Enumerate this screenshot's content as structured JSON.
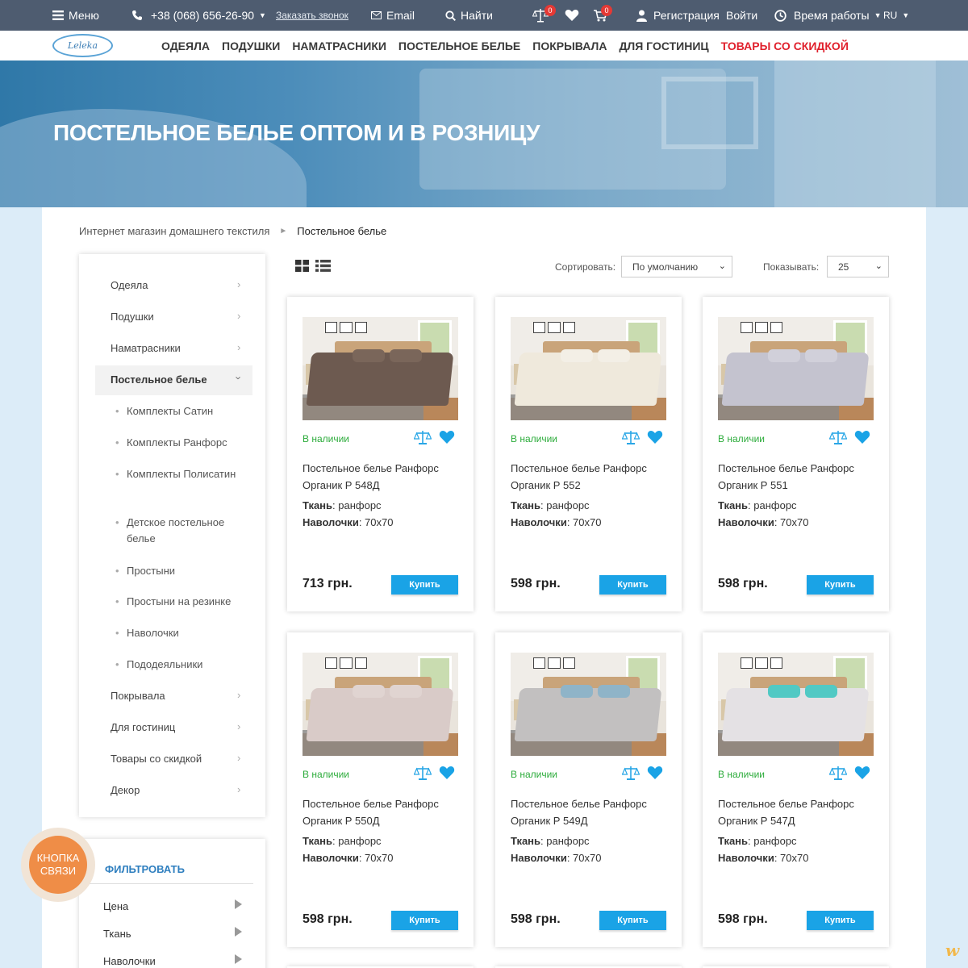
{
  "topbar": {
    "menu": "Меню",
    "phone": "+38 (068) 656-26-90",
    "callback": "Заказать звонок",
    "email": "Email",
    "search": "Найти",
    "compare_count": "0",
    "cart_count": "0",
    "register": "Регистрация",
    "login": "Войти",
    "hours": "Время работы",
    "lang": "RU"
  },
  "nav": {
    "logo": "Leleka",
    "items": [
      "ОДЕЯЛА",
      "ПОДУШКИ",
      "НАМАТРАСНИКИ",
      "ПОСТЕЛЬНОЕ БЕЛЬЕ",
      "ПОКРЫВАЛА",
      "ДЛЯ ГОСТИНИЦ"
    ],
    "sale": "ТОВАРЫ СО СКИДКОЙ",
    "sale_color": "#e0202c"
  },
  "hero": {
    "title": "ПОСТЕЛЬНОЕ БЕЛЬЕ ОПТОМ И В РОЗНИЦУ"
  },
  "breadcrumb": {
    "home": "Интернет магазин домашнего текстиля",
    "current": "Постельное белье"
  },
  "sidebar": {
    "top": [
      "Одеяла",
      "Подушки",
      "Наматрасники"
    ],
    "active": "Постельное белье",
    "sub": [
      "Комплекты Сатин",
      "Комплекты Ранфорс",
      "Комплекты Полисатин",
      "Детское постельное белье",
      "Простыни",
      "Простыни на резинке",
      "Наволочки",
      "Пододеяльники"
    ],
    "bottom": [
      "Покрывала",
      "Для гостиниц",
      "Товары со скидкой",
      "Декор"
    ]
  },
  "filter": {
    "title": "ФИЛЬТРОВАТЬ",
    "rows": [
      "Цена",
      "Ткань",
      "Наволочки"
    ]
  },
  "contact_button": "КНОПКА СВЯЗИ",
  "toolbar": {
    "sort_label": "Сортировать:",
    "sort_value": "По умолчанию",
    "show_label": "Показывать:",
    "show_value": "25"
  },
  "product_labels": {
    "available": "В наличии",
    "fabric_label": "Ткань",
    "fabric_value": ": ранфорс",
    "pillow_label": "Наволочки",
    "pillow_value": ": 70x70",
    "buy": "Купить"
  },
  "products": [
    {
      "name": "Постельное белье Ранфорс Органик Р 548Д",
      "price": "713 грн.",
      "bed_color": "#6d5a50",
      "pillow_color": "#7a665a"
    },
    {
      "name": "Постельное белье Ранфорс Органик Р 552",
      "price": "598 грн.",
      "bed_color": "#efe9dc",
      "pillow_color": "#f3efe6"
    },
    {
      "name": "Постельное белье Ранфорс Органик Р 551",
      "price": "598 грн.",
      "bed_color": "#c4c3cf",
      "pillow_color": "#d1d0da"
    },
    {
      "name": "Постельное белье Ранфорс Органик Р 550Д",
      "price": "598 грн.",
      "bed_color": "#d9cbc8",
      "pillow_color": "#e0d4d1"
    },
    {
      "name": "Постельное белье Ранфорс Органик Р 549Д",
      "price": "598 грн.",
      "bed_color": "#c2c0c0",
      "pillow_color": "#8fb4c8"
    },
    {
      "name": "Постельное белье Ранфорс Органик Р 547Д",
      "price": "598 грн.",
      "bed_color": "#e4e1e4",
      "pillow_color": "#51c9c4"
    }
  ],
  "colors": {
    "topbar": "#4e5c70",
    "accent": "#1aa3e6",
    "available": "#2bab3a",
    "contact": "#ef8d47"
  }
}
